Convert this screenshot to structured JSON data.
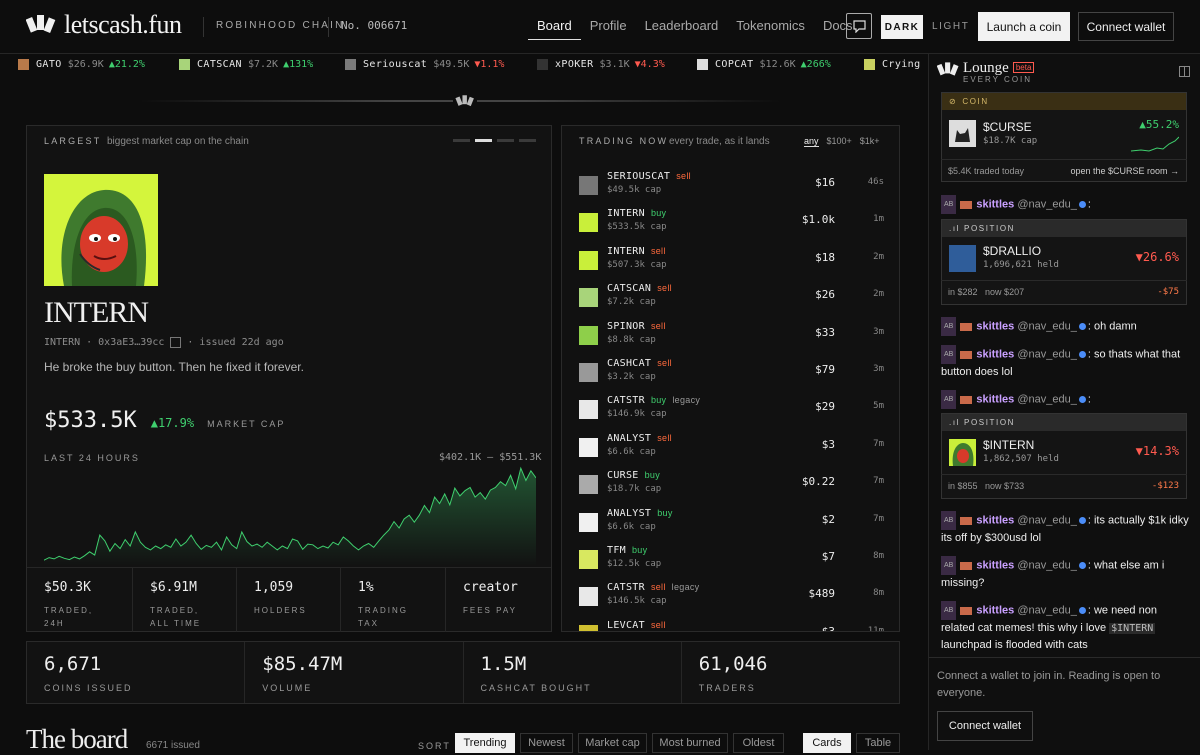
{
  "header": {
    "brand": "letscash.fun",
    "chain": "ROBINHOOD CHAIN",
    "number": "No. 006671",
    "nav": [
      "Board",
      "Profile",
      "Leaderboard",
      "Tokenomics",
      "Docs"
    ],
    "theme_dark": "DARK",
    "theme_light": "LIGHT",
    "launch": "Launch a coin",
    "connect": "Connect wallet"
  },
  "ticker": [
    {
      "sym": "GATO",
      "val": "$26.9K",
      "chg": "▲21.2%",
      "dir": "up",
      "color": "#b97a4a"
    },
    {
      "sym": "CATSCAN",
      "val": "$7.2K",
      "chg": "▲131%",
      "dir": "up",
      "color": "#a8d47a"
    },
    {
      "sym": "Seriouscat",
      "val": "$49.5K",
      "chg": "▼1.1%",
      "dir": "dn",
      "color": "#7a7a7a"
    },
    {
      "sym": "xPOKER",
      "val": "$3.1K",
      "chg": "▼4.3%",
      "dir": "dn",
      "color": "#333"
    },
    {
      "sym": "COPCAT",
      "val": "$12.6K",
      "chg": "▲266%",
      "dir": "up",
      "color": "#ddd"
    },
    {
      "sym": "Crying",
      "val": "",
      "chg": "",
      "dir": "up",
      "color": "#c8d060"
    }
  ],
  "largest": {
    "label": "LARGEST",
    "sub": "biggest market cap on the chain",
    "name": "INTERN",
    "ticker": "INTERN",
    "address": "0x3aE3…39cc",
    "issued": "issued 22d ago",
    "desc": "He broke the buy button. Then he fixed it forever.",
    "mcap": "$533.5K",
    "change": "▲17.9%",
    "mcap_label": "MARKET CAP",
    "period": "LAST 24 HOURS",
    "range": "$402.1K – $551.3K",
    "stats": [
      {
        "v": "$50.3K",
        "l1": "TRADED,",
        "l2": "24H"
      },
      {
        "v": "$6.91M",
        "l1": "TRADED,",
        "l2": "ALL TIME"
      },
      {
        "v": "1,059",
        "l1": "HOLDERS",
        "l2": ""
      },
      {
        "v": "1%",
        "l1": "TRADING",
        "l2": "TAX"
      },
      {
        "v": "creator",
        "l1": "FEES PAY",
        "l2": ""
      }
    ]
  },
  "chart_data": {
    "type": "line",
    "title": "",
    "xlabel": "",
    "ylabel": "",
    "ylim": [
      402.1,
      551.3
    ],
    "values": [
      408,
      412,
      410,
      414,
      411,
      409,
      413,
      410,
      415,
      421,
      416,
      447,
      438,
      422,
      434,
      426,
      440,
      430,
      452,
      436,
      428,
      424,
      430,
      426,
      432,
      428,
      441,
      430,
      436,
      447,
      434,
      425,
      431,
      428,
      436,
      424,
      444,
      432,
      426,
      452,
      437,
      430,
      433,
      428,
      436,
      430,
      424,
      430,
      426,
      441,
      438,
      425,
      433,
      432,
      426,
      430,
      427,
      436,
      432,
      444,
      438,
      430,
      424,
      430,
      434,
      428,
      438,
      447,
      455,
      468,
      458,
      472,
      478,
      467,
      478,
      493,
      482,
      506,
      496,
      511,
      494,
      520,
      508,
      516,
      521,
      506,
      513,
      503,
      517,
      521,
      530,
      524,
      540,
      519,
      551,
      532,
      547,
      536
    ]
  },
  "trading": {
    "label": "TRADING NOW",
    "sub": "every trade, as it lands",
    "filters": [
      "any",
      "$100+",
      "$1k+"
    ],
    "rows": [
      {
        "name": "SERIOUSCAT",
        "side": "sell",
        "legacy": "",
        "cap": "$49.5k cap",
        "amt": "$16",
        "t": "46s",
        "color": "#777"
      },
      {
        "name": "INTERN",
        "side": "buy",
        "legacy": "",
        "cap": "$533.5k cap",
        "amt": "$1.0k",
        "t": "1m",
        "color": "#c9ef3a"
      },
      {
        "name": "INTERN",
        "side": "sell",
        "legacy": "",
        "cap": "$507.3k cap",
        "amt": "$18",
        "t": "2m",
        "color": "#c9ef3a"
      },
      {
        "name": "CATSCAN",
        "side": "sell",
        "legacy": "",
        "cap": "$7.2k cap",
        "amt": "$26",
        "t": "2m",
        "color": "#a8d47a"
      },
      {
        "name": "SPINOR",
        "side": "sell",
        "legacy": "",
        "cap": "$8.8k cap",
        "amt": "$33",
        "t": "3m",
        "color": "#8ecf4a"
      },
      {
        "name": "CASHCAT",
        "side": "sell",
        "legacy": "",
        "cap": "$3.2k cap",
        "amt": "$79",
        "t": "3m",
        "color": "#999"
      },
      {
        "name": "CATSTR",
        "side": "buy",
        "legacy": "legacy",
        "cap": "$146.9k cap",
        "amt": "$29",
        "t": "5m",
        "color": "#e8e8e8"
      },
      {
        "name": "ANALYST",
        "side": "sell",
        "legacy": "",
        "cap": "$6.6k cap",
        "amt": "$3",
        "t": "7m",
        "color": "#f0f0f0"
      },
      {
        "name": "CURSE",
        "side": "buy",
        "legacy": "",
        "cap": "$18.7k cap",
        "amt": "$0.22",
        "t": "7m",
        "color": "#aaa"
      },
      {
        "name": "ANALYST",
        "side": "buy",
        "legacy": "",
        "cap": "$6.6k cap",
        "amt": "$2",
        "t": "7m",
        "color": "#f0f0f0"
      },
      {
        "name": "TFM",
        "side": "buy",
        "legacy": "",
        "cap": "$12.5k cap",
        "amt": "$7",
        "t": "8m",
        "color": "#d8e860"
      },
      {
        "name": "CATSTR",
        "side": "sell",
        "legacy": "legacy",
        "cap": "$146.5k cap",
        "amt": "$489",
        "t": "8m",
        "color": "#e8e8e8"
      },
      {
        "name": "LEVCAT",
        "side": "sell",
        "legacy": "",
        "cap": "",
        "amt": "$3",
        "t": "11m",
        "color": "#d0c030"
      }
    ]
  },
  "bottom": [
    {
      "v": "6,671",
      "l": "COINS ISSUED"
    },
    {
      "v": "$85.47M",
      "l": "VOLUME"
    },
    {
      "v": "1.5M",
      "l": "CASHCAT BOUGHT"
    },
    {
      "v": "61,046",
      "l": "TRADERS"
    }
  ],
  "board": {
    "title": "The board",
    "issued": "6671 issued",
    "sort": "SORT",
    "sorts": [
      "Trending",
      "Newest",
      "Market cap",
      "Most burned",
      "Oldest"
    ],
    "views": [
      "Cards",
      "Table"
    ]
  },
  "lounge": {
    "title": "Lounge",
    "beta": "beta",
    "sub": "EVERY COIN",
    "coin_card": {
      "head": "COIN",
      "sym": "$CURSE",
      "cap": "$18.7K cap",
      "chg": "▲55.2%",
      "traded": "$5.4K traded today",
      "open": "open the $CURSE room →"
    },
    "user": {
      "badge": "AB",
      "name": "skittles",
      "handle": "@nav_edu_"
    },
    "pos1": {
      "head": "POSITION",
      "sym": "$DRALLIO",
      "held": "1,696,621 held",
      "chg": "▼26.6%",
      "in": "in $282",
      "now": "now $207",
      "pl": "-$75"
    },
    "pos2": {
      "head": "POSITION",
      "sym": "$INTERN",
      "held": "1,862,507 held",
      "chg": "▼14.3%",
      "in": "in $855",
      "now": "now $733",
      "pl": "-$123"
    },
    "msgs": [
      "oh damn",
      "so thats what that button does lol",
      "its actually $1k idky its off by $300usd lol",
      "what else am i missing?"
    ],
    "last_msg_a": "we need non related cat memes! this why i love",
    "last_msg_tag": "$INTERN",
    "last_msg_b": "launchpad is flooded with cats",
    "join": "Connect a wallet to join in. Reading is open to everyone.",
    "connect": "Connect wallet"
  }
}
